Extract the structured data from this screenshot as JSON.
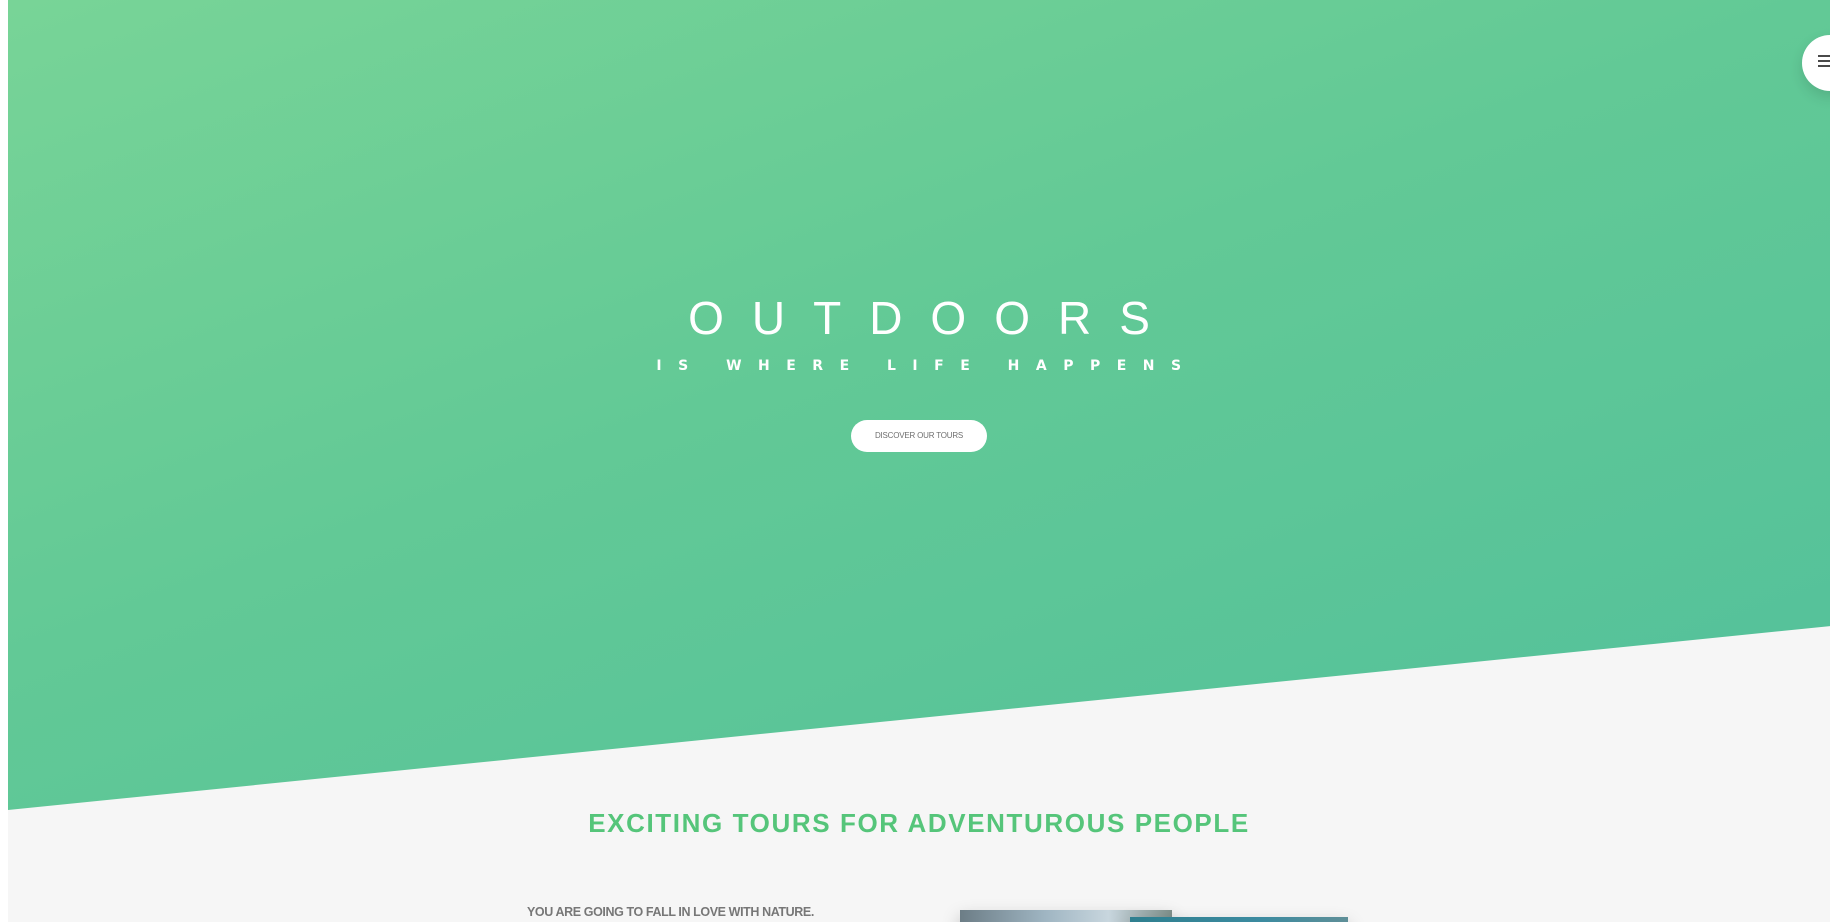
{
  "hero": {
    "title": "OUTDOORS",
    "subtitle": "IS WHERE LIFE HAPPENS",
    "cta_label": "DISCOVER OUR TOURS",
    "gradient_from": "#7ed56f",
    "gradient_to": "#28b485"
  },
  "navigation": {
    "menu_icon": "hamburger-menu-icon"
  },
  "about": {
    "heading": "EXCITING TOURS FOR ADVENTUROUS PEOPLE",
    "subheading": "YOU ARE GOING TO FALL IN LOVE WITH NATURE.",
    "accent_color": "#55c57a",
    "photo_1": "nature-photo-1",
    "photo_2": "nature-photo-2"
  }
}
